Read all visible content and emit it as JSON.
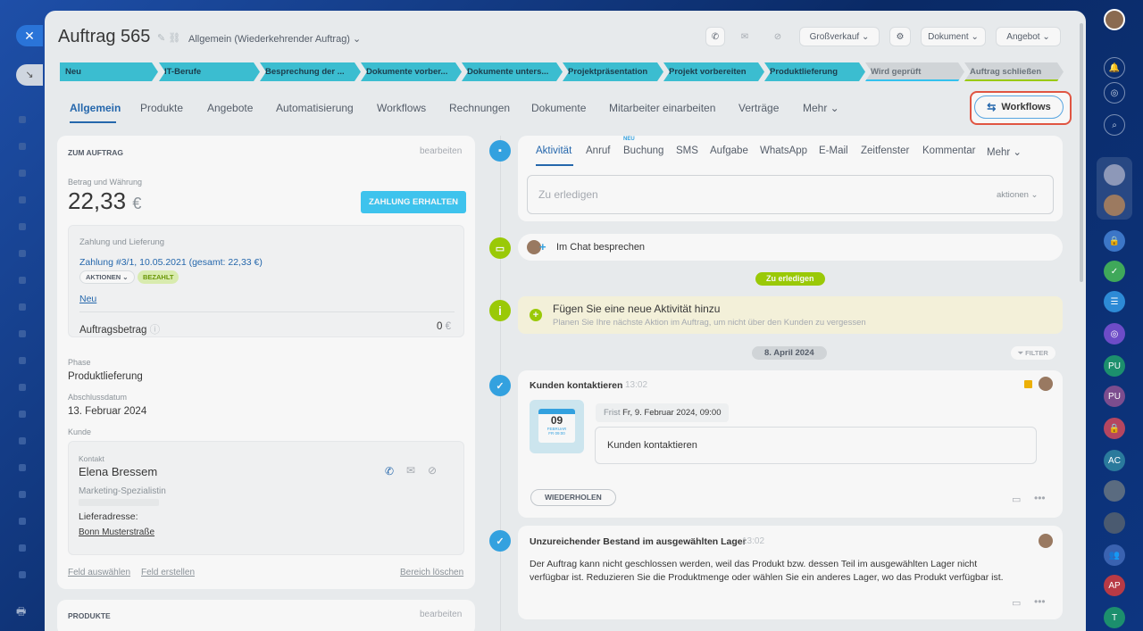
{
  "header": {
    "title": "Auftrag 565",
    "subtitle": "Allgemein (Wiederkehrender Auftrag)",
    "buttons": {
      "grosverkauf": "Großverkauf",
      "dokument": "Dokument",
      "angebot": "Angebot"
    }
  },
  "stages": [
    "Neu",
    "IT-Berufe",
    "Besprechung der ...",
    "Dokumente vorber...",
    "Dokumente unters...",
    "Projektpräsentation",
    "Projekt vorbereiten",
    "Produktlieferung",
    "Wird geprüft",
    "Auftrag schließen"
  ],
  "tabs": [
    "Allgemein",
    "Produkte",
    "Angebote",
    "Automatisierung",
    "Workflows",
    "Rechnungen",
    "Dokumente",
    "Mitarbeiter einarbeiten",
    "Verträge",
    "Mehr"
  ],
  "workflows_button": "Workflows",
  "order": {
    "section_title": "ZUM AUFTRAG",
    "edit_label": "bearbeiten",
    "amount_label": "Betrag und Währung",
    "amount": "22,33",
    "currency": "€",
    "payment_button": "ZAHLUNG ERHALTEN",
    "payment_section": "Zahlung und Lieferung",
    "payment_link": "Zahlung #3/1, 10.05.2021 (gesamt: 22,33 €)",
    "actions_pill": "AKTIONEN",
    "paid_pill": "BEZAHLT",
    "new_link": "Neu",
    "order_amount_label": "Auftragsbetrag",
    "order_amount_value": "0",
    "order_amount_currency": "€",
    "phase_label": "Phase",
    "phase_value": "Produktlieferung",
    "close_date_label": "Abschlussdatum",
    "close_date_value": "13. Februar 2024",
    "customer_label": "Kunde",
    "contact_label": "Kontakt",
    "contact_name": "Elena Bressem",
    "contact_role": "Marketing-Spezialistin",
    "delivery_label": "Lieferadresse:",
    "delivery_value": "Bonn Musterstraße",
    "field_select": "Feld auswählen",
    "field_create": "Feld erstellen",
    "delete_area": "Bereich löschen"
  },
  "products": {
    "section_title": "PRODUKTE",
    "edit_label": "bearbeiten"
  },
  "activity": {
    "tabs": [
      "Aktivität",
      "Anruf",
      "Buchung",
      "SMS",
      "Aufgabe",
      "WhatsApp",
      "E-Mail",
      "Zeitfenster",
      "Kommentar",
      "Mehr"
    ],
    "new_badge": "NEU",
    "todo_placeholder": "Zu erledigen",
    "actions_label": "aktionen",
    "chat_label": "Im Chat besprechen",
    "todo_badge": "Zu erledigen",
    "add_title": "Fügen Sie eine neue Aktivität hinzu",
    "add_desc": "Planen Sie Ihre nächste Aktion im Auftrag, um nicht über den Kunden zu vergessen",
    "date_badge": "8. April 2024",
    "filter_label": "FILTER"
  },
  "task1": {
    "title": "Kunden kontaktieren",
    "time": "13:02",
    "cal_day": "09",
    "cal_month": "FEBRUAR",
    "cal_time": "FR 09:00",
    "deadline_prefix": "Frist",
    "deadline": "Fr, 9. Februar 2024, 09:00",
    "body": "Kunden kontaktieren",
    "repeat_button": "WIEDERHOLEN"
  },
  "task2": {
    "title": "Unzureichender Bestand im ausgewählten Lager",
    "time": "13:02",
    "body_line1": "Der Auftrag kann nicht geschlossen werden, weil das Produkt bzw. dessen Teil im ausgewählten Lager nicht",
    "body_line2": "verfügbar ist. Reduzieren Sie die Produktmenge oder wählen Sie ein anderes Lager, wo das Produkt verfügbar ist."
  },
  "right_rail": {
    "initials": [
      "PU",
      "PU",
      "AC",
      "AP",
      "T"
    ]
  },
  "colors": {
    "accent": "#2066b0",
    "stage": "#38c2d6",
    "green": "#9dcf00",
    "highlight": "#e7533f"
  }
}
